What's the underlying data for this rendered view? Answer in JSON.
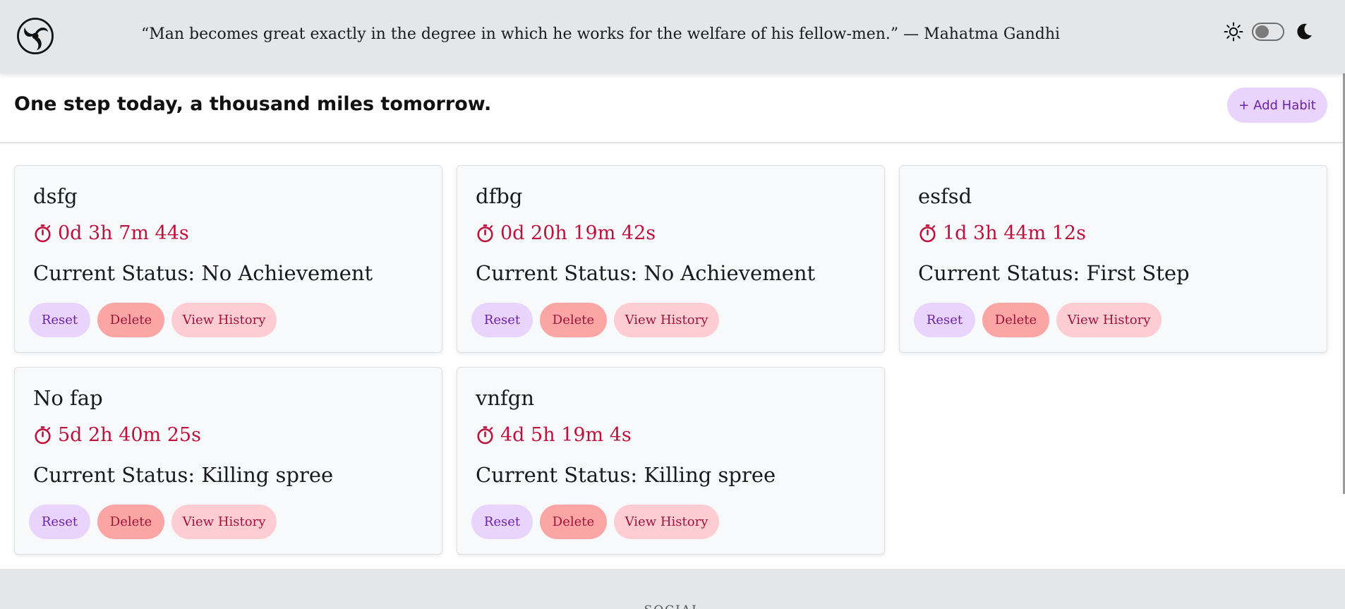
{
  "header": {
    "quote": "“Man becomes great exactly in the degree in which he works for the welfare of his fellow-men.” — Mahatma Gandhi",
    "theme_toggle": {
      "dark_mode": false
    }
  },
  "page": {
    "headline": "One step today, a thousand miles tomorrow.",
    "add_button_label": "+ Add Habit"
  },
  "habits": [
    {
      "name": "dsfg",
      "elapsed": "0d 3h 7m 44s",
      "status": "Current Status: No Achievement"
    },
    {
      "name": "dfbg",
      "elapsed": "0d 20h 19m 42s",
      "status": "Current Status: No Achievement"
    },
    {
      "name": "esfsd",
      "elapsed": "1d 3h 44m 12s",
      "status": "Current Status: First Step"
    },
    {
      "name": "No fap",
      "elapsed": "5d 2h 40m 25s",
      "status": "Current Status: Killing spree"
    },
    {
      "name": "vnfgn",
      "elapsed": "4d 5h 19m 4s",
      "status": "Current Status: Killing spree"
    }
  ],
  "card_actions": {
    "reset_label": "Reset",
    "delete_label": "Delete",
    "history_label": "View History"
  },
  "footer": {
    "title": "SOCIAL"
  },
  "colors": {
    "header_bg": "#e5e6e8",
    "timer": "#be123c",
    "reset_bg": "#e9d4fd",
    "delete_bg": "#fca5a5",
    "history_bg": "#fecdd3"
  },
  "icons": {
    "logo": "swirl-logo-icon",
    "light_mode": "sun-icon",
    "dark_mode": "moon-icon",
    "timer": "stopwatch-icon"
  }
}
